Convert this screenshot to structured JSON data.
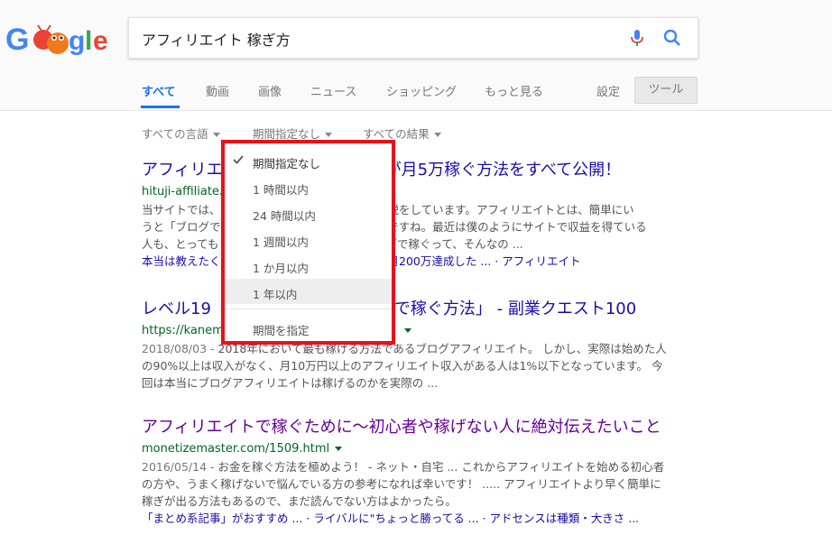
{
  "search": {
    "query": "アフィリエイト 稼ぎ方"
  },
  "tabs": [
    {
      "label": "すべて"
    },
    {
      "label": "動画"
    },
    {
      "label": "画像"
    },
    {
      "label": "ニュース"
    },
    {
      "label": "ショッピング"
    },
    {
      "label": "もっと見る"
    }
  ],
  "settings_label": "設定",
  "tools_label": "ツール",
  "filters": {
    "language": "すべての言語",
    "period": "期間指定なし",
    "results": "すべての結果"
  },
  "period_menu": {
    "items": [
      "期間指定なし",
      "1 時間以内",
      "24 時間以内",
      "1 週間以内",
      "1 か月以内",
      "1 年以内"
    ],
    "custom": "期間を指定"
  },
  "results": [
    {
      "title_left": "アフィリエ",
      "title_right": "が月5万稼ぐ方法をすべて公開！",
      "url": "hituji-affiliate.c",
      "snippet_lines": [
        "当サイトでは、",
        "うと「ブログで",
        "人も、とっても"
      ],
      "snippet_lines_right": [
        "て解説をしています。アフィリエイトとは、簡単にい",
        "ことですね。最近は僕のようにサイトで収益を得ている",
        "ブログで稼ぐって、そんなの ..."
      ],
      "links_left": "本当は教えたく",
      "links_right": "グ】月200万達成した ... · アフィリエイト"
    },
    {
      "title_left": "レベル19「",
      "title_right": "で稼ぐ方法」 - 副業クエスト100",
      "url": "https://kanemo",
      "date": "2018/08/03 -",
      "snippet_lines": [
        "2018年において最も稼げる方法であるブログアフィリエイト。 しかし、実際は始めた人",
        "の90%以上は収入がなく、月10万円以上のアフィリエイト収入がある人は1%以下となっています。 今",
        "回は本当にブログアフィリエイトは稼げるのかを実際の ..."
      ]
    },
    {
      "title": "アフィリエイトで稼ぐために～初心者や稼げない人に絶対伝えたいこと",
      "url": "monetizemaster.com/1509.html",
      "date": "2016/05/14 -",
      "snippet_lines": [
        "お金を稼ぐ方法を極めよう！ - ネット・自宅 ... これからアフィリエイトを始める初心者",
        "の方や、うまく稼げないで悩んでいる方の参考になれば幸いです！ ..... アフィリエイトより早く簡単に",
        "稼ぎが出る方法もあるので、まだ読んでない方はよかったら。"
      ],
      "links": "「まとめ系記事」がおすすめ ... · ライバルに\"ちょっと勝ってる ... · アドセンスは種類・大きさ ..."
    }
  ]
}
